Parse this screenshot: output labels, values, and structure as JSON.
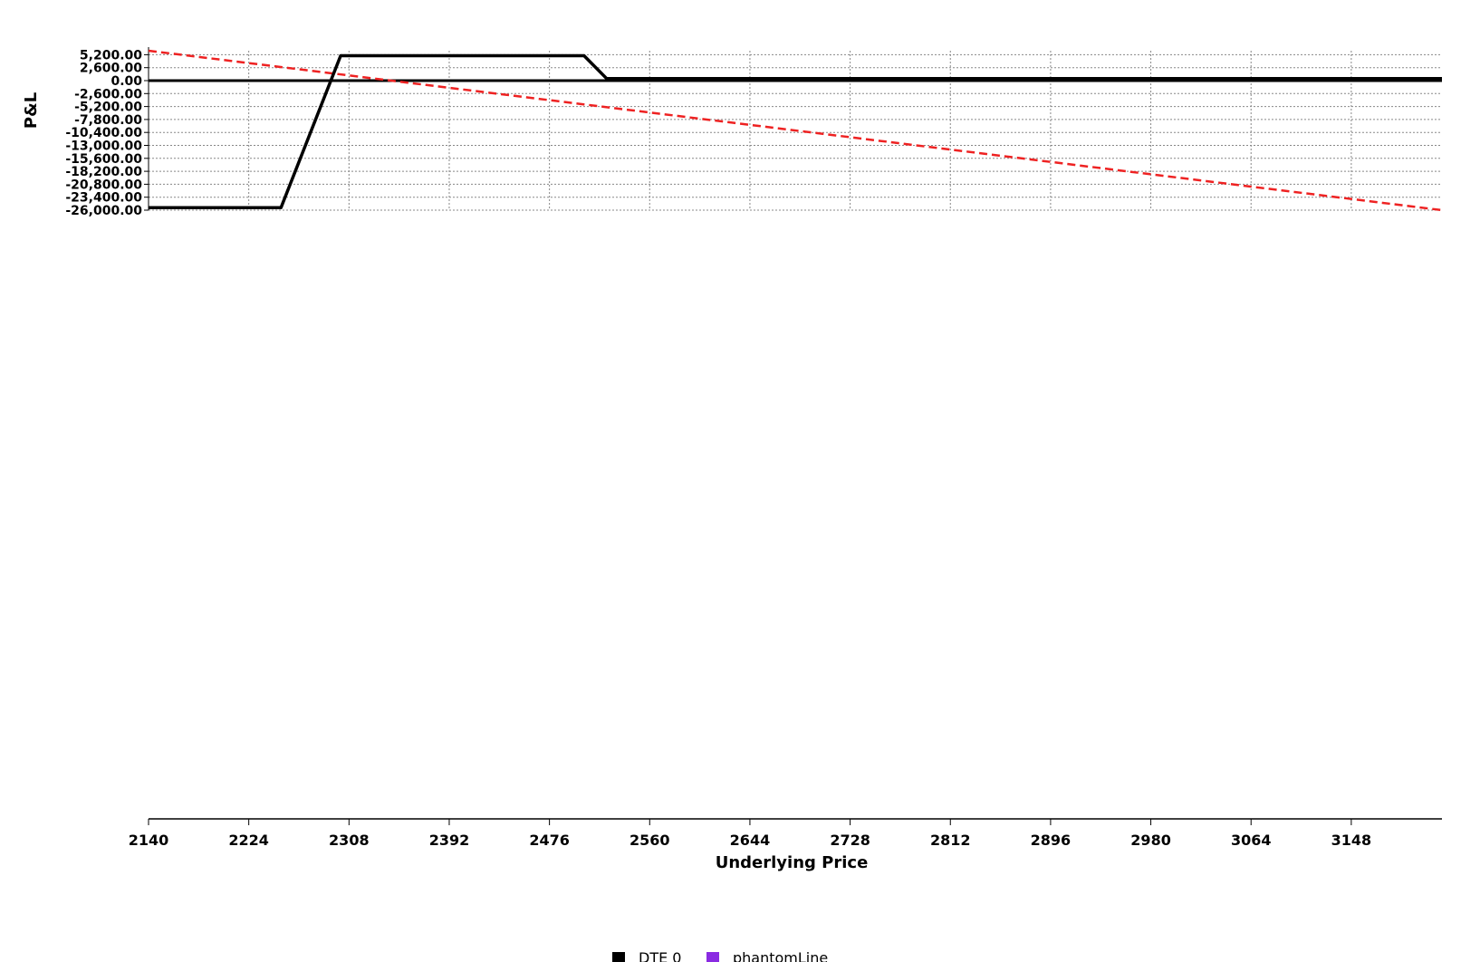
{
  "chart_data": {
    "type": "line",
    "xlabel": "Underlying Price",
    "ylabel": "P&L",
    "xlim": [
      2140,
      3224
    ],
    "ylim": [
      -26000,
      6000
    ],
    "x_ticks": [
      "2140",
      "2224",
      "2308",
      "2392",
      "2476",
      "2560",
      "2644",
      "2728",
      "2812",
      "2896",
      "2980",
      "3064",
      "3148"
    ],
    "y_ticks": [
      "5,200.00",
      "2,600.00",
      "0.00",
      "-2,600.00",
      "-5,200.00",
      "-7,800.00",
      "-10,400.00",
      "-13,000.00",
      "-15,600.00",
      "-18,200.00",
      "-20,800.00",
      "-23,400.00",
      "-26,000.00"
    ],
    "grid": true,
    "legend_position": "bottom",
    "series": [
      {
        "name": "DTE 0",
        "color": "#000000",
        "style": "solid",
        "points": [
          [
            2140,
            -25500
          ],
          [
            2251,
            -25500
          ],
          [
            2301,
            5000
          ],
          [
            2505,
            5000
          ],
          [
            2524,
            400
          ],
          [
            3224,
            400
          ]
        ]
      },
      {
        "name": "phantomLine",
        "color": "#8a2be2",
        "style": "solid",
        "points": [
          [
            2140,
            0
          ],
          [
            3224,
            0
          ]
        ]
      }
    ],
    "annotations": [
      {
        "label": "",
        "color": "#ee2222",
        "style": "dashed",
        "points": [
          [
            2140,
            6000
          ],
          [
            3224,
            -26000
          ]
        ]
      }
    ]
  }
}
